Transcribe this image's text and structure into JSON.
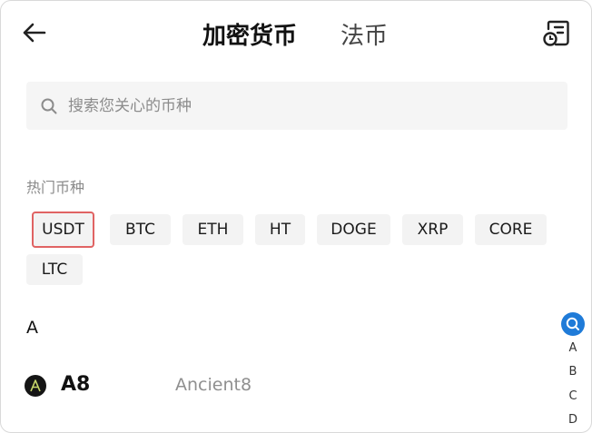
{
  "header": {
    "tabs": [
      {
        "label": "加密货币",
        "active": true
      },
      {
        "label": "法币",
        "active": false
      }
    ]
  },
  "icons": {
    "back": "arrow-left-icon",
    "history": "order-history-icon",
    "search": "search-icon"
  },
  "search": {
    "placeholder": "搜索您关心的币种",
    "value": ""
  },
  "hot": {
    "label": "热门币种",
    "coins": [
      "USDT",
      "BTC",
      "ETH",
      "HT",
      "DOGE",
      "XRP",
      "CORE",
      "LTC"
    ],
    "highlighted": "USDT"
  },
  "list": {
    "groups": [
      {
        "letter": "A",
        "items": [
          {
            "symbol": "A8",
            "name": "Ancient8"
          }
        ]
      }
    ]
  },
  "index": {
    "letters": [
      "A",
      "B",
      "C",
      "D"
    ]
  },
  "colors": {
    "accent": "#1f7bd8",
    "highlight_border": "#e06363",
    "chip_bg": "#f3f3f3",
    "search_bg": "#f5f5f5",
    "muted_text": "#8a8a8a"
  }
}
